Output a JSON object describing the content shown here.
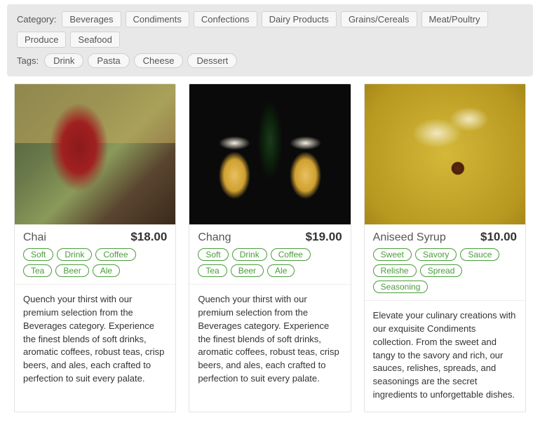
{
  "filters": {
    "category_label": "Category:",
    "categories": [
      "Beverages",
      "Condiments",
      "Confections",
      "Dairy Products",
      "Grains/Cereals",
      "Meat/Poultry",
      "Produce",
      "Seafood"
    ],
    "tags_label": "Tags:",
    "tags": [
      "Drink",
      "Pasta",
      "Cheese",
      "Dessert"
    ]
  },
  "products": [
    {
      "title": "Chai",
      "price": "$18.00",
      "tags": [
        "Soft",
        "Drink",
        "Coffee",
        "Tea",
        "Beer",
        "Ale"
      ],
      "desc": "Quench your thirst with our premium selection from the Beverages category. Experience the finest blends of soft drinks, aromatic coffees, robust teas, crisp beers, and ales, each crafted to perfection to suit every palate.",
      "img_class": "img-chai",
      "img_name": "product-image-chai"
    },
    {
      "title": "Chang",
      "price": "$19.00",
      "tags": [
        "Soft",
        "Drink",
        "Coffee",
        "Tea",
        "Beer",
        "Ale"
      ],
      "desc": "Quench your thirst with our premium selection from the Beverages category. Experience the finest blends of soft drinks, aromatic coffees, robust teas, crisp beers, and ales, each crafted to perfection to suit every palate.",
      "img_class": "img-chang",
      "img_name": "product-image-chang"
    },
    {
      "title": "Aniseed Syrup",
      "price": "$10.00",
      "tags": [
        "Sweet",
        "Savory",
        "Sauce",
        "Relishe",
        "Spread",
        "Seasoning"
      ],
      "desc": "Elevate your culinary creations with our exquisite Condiments collection. From the sweet and tangy to the savory and rich, our sauces, relishes, spreads, and seasonings are the secret ingredients to unforgettable dishes.",
      "img_class": "img-aniseed",
      "img_name": "product-image-aniseed"
    }
  ]
}
